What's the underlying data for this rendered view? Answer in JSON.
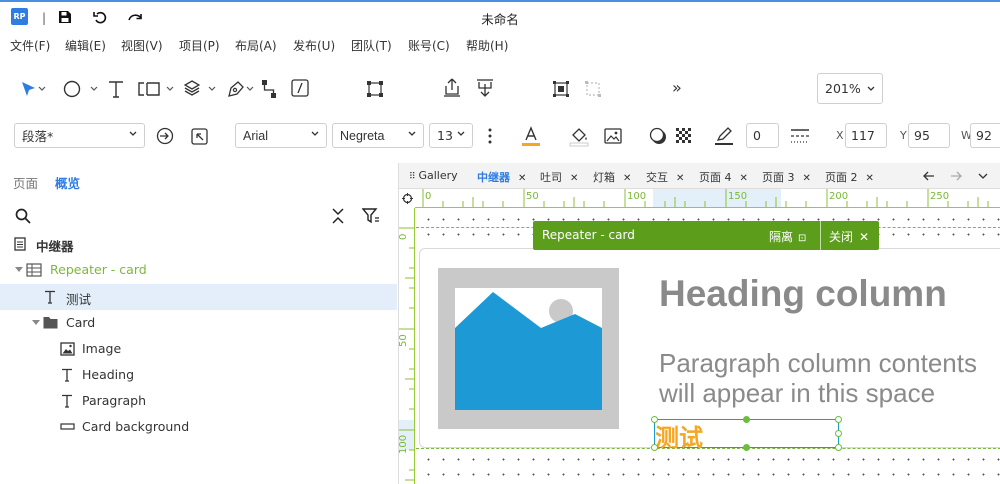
{
  "app": {
    "logo_text": "RP",
    "window_title": "未命名"
  },
  "titlebar": {
    "save_icon": "save-icon",
    "undo_icon": "undo-icon",
    "redo_icon": "redo-icon"
  },
  "menu": [
    "文件(F)",
    "编辑(E)",
    "视图(V)",
    "项目(P)",
    "布局(A)",
    "发布(U)",
    "团队(T)",
    "账号(C)",
    "帮助(H)"
  ],
  "toolbar": {
    "zoom": "201%",
    "more": "»"
  },
  "style_bar": {
    "style": "段落*",
    "font_family": "Arial",
    "font_weight": "Negreta",
    "font_size": "13",
    "border_width": "0",
    "x_label": "X",
    "x_value": "117",
    "y_label": "Y",
    "y_value": "95",
    "w_label": "W",
    "w_value": "92",
    "text_color": "#f5a623"
  },
  "left_panel": {
    "tabs": [
      "页面",
      "概览"
    ],
    "active_tab": "概览",
    "tree": [
      {
        "label": "中继器",
        "icon": "page-icon",
        "level": 0,
        "bold": true
      },
      {
        "label": "Repeater - card",
        "icon": "repeater-icon",
        "level": 1,
        "color": "#7cb83a",
        "expanded": true
      },
      {
        "label": "测试",
        "icon": "text-icon",
        "level": 2,
        "selected": true
      },
      {
        "label": "Card",
        "icon": "folder-icon",
        "level": 2,
        "expanded": true
      },
      {
        "label": "Image",
        "icon": "image-icon",
        "level": 3
      },
      {
        "label": "Heading",
        "icon": "text-icon",
        "level": 3
      },
      {
        "label": "Paragraph",
        "icon": "text-icon",
        "level": 3
      },
      {
        "label": "Card background",
        "icon": "rectangle-icon",
        "level": 3
      }
    ]
  },
  "canvas": {
    "tabs": [
      {
        "label": "Gallery",
        "closable": false,
        "active": false
      },
      {
        "label": "中继器",
        "closable": true,
        "active": true
      },
      {
        "label": "吐司",
        "closable": true,
        "active": false
      },
      {
        "label": "灯箱",
        "closable": true,
        "active": false
      },
      {
        "label": "交互",
        "closable": true,
        "active": false
      },
      {
        "label": "页面 4",
        "closable": true,
        "active": false
      },
      {
        "label": "页面 3",
        "closable": true,
        "active": false
      },
      {
        "label": "页面 2",
        "closable": true,
        "active": false
      }
    ],
    "ruler_h": [
      "0",
      "50",
      "100",
      "150",
      "200",
      "250"
    ],
    "ruler_v": [
      "0",
      "50",
      "100"
    ],
    "repeater_bar": {
      "title": "Repeater - card",
      "isolate": "隔离",
      "close": "关闭"
    },
    "card": {
      "heading": "Heading column",
      "paragraph_line1": "Paragraph column contents",
      "paragraph_line2": "will appear in this space",
      "selected_text": "测试"
    }
  }
}
